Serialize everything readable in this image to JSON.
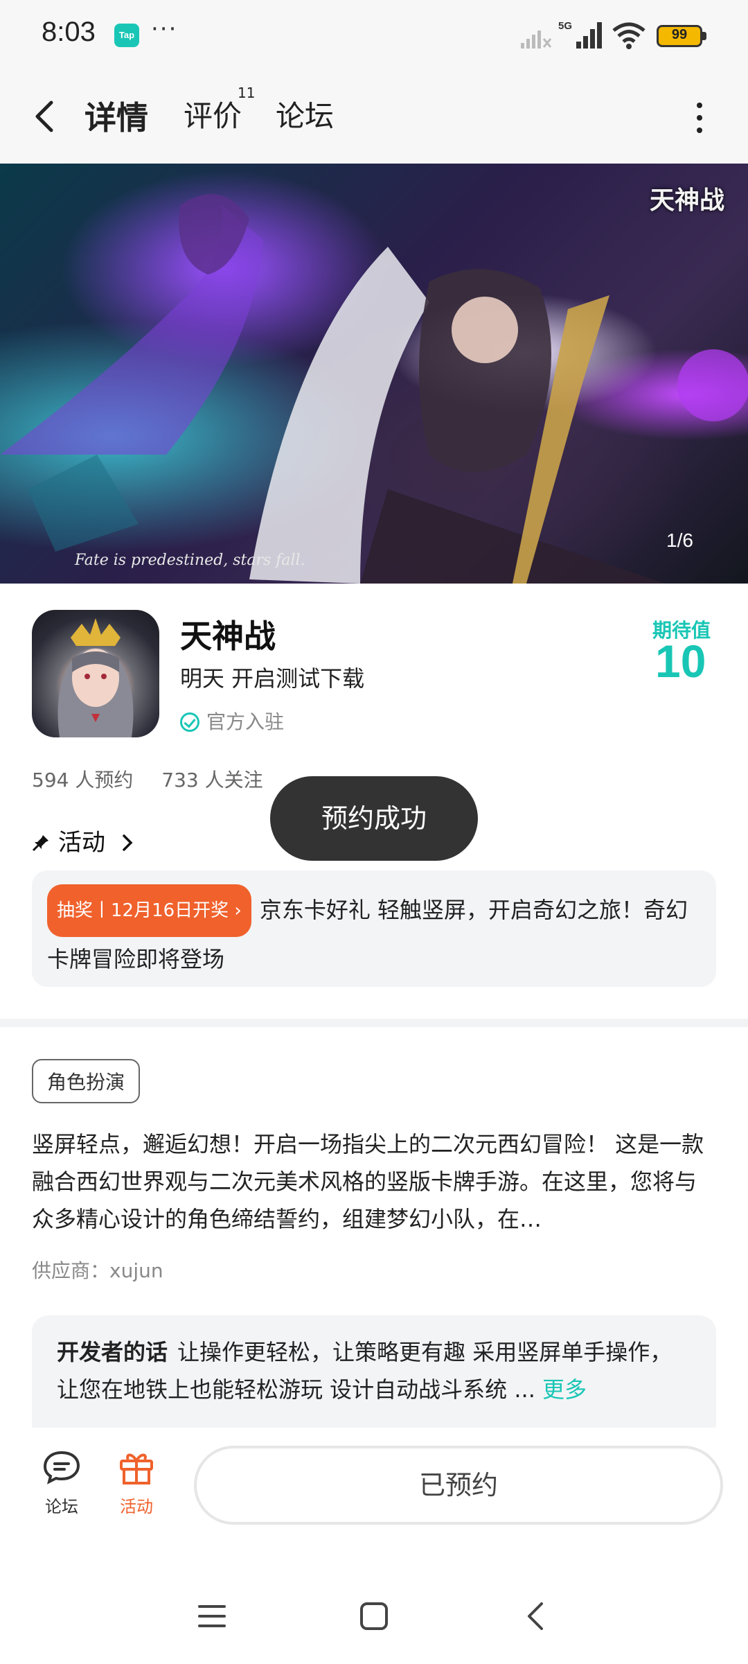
{
  "status_bar": {
    "time": "8:03",
    "app_badge": "Tap",
    "dots": "···",
    "network": "5G",
    "battery": "99"
  },
  "header": {
    "tabs": [
      {
        "label": "详情",
        "active": true
      },
      {
        "label": "评价",
        "badge": "11"
      },
      {
        "label": "论坛"
      }
    ]
  },
  "banner": {
    "logo_text": "天神战",
    "tagline": "Fate is predestined, stars fall.",
    "counter": "1/6"
  },
  "game": {
    "title": "天神战",
    "subtitle": "明天 开启测试下载",
    "official_label": "官方入驻",
    "expect_label": "期待值",
    "expect_value": "10"
  },
  "stats": {
    "reservations": "594 人预约",
    "follows": "733 人关注"
  },
  "activity": {
    "section_label": "活动",
    "lottery_tag": "抽奖丨12月16日开奖",
    "text": "京东卡好礼 轻触竖屏，开启奇幻之旅！奇幻卡牌冒险即将登场"
  },
  "toast": "预约成功",
  "tag": "角色扮演",
  "description": "竖屏轻点，邂逅幻想！开启一场指尖上的二次元西幻冒险！ 这是一款融合西幻世界观与二次元美术风格的竖版卡牌手游。在这里，您将与众多精心设计的角色缔结誓约，组建梦幻小队，在…",
  "supplier": "供应商：xujun",
  "developer": {
    "title": "开发者的话",
    "text": "让操作更轻松，让策略更有趣 采用竖屏单手操作，让您在地铁上也能轻松游玩 设计自动战斗系统 ...",
    "more": "更多"
  },
  "bottom_bar": {
    "forum_label": "论坛",
    "activity_label": "活动",
    "reserve_label": "已预约"
  },
  "colors": {
    "accent": "#19c6b5",
    "orange": "#f0612c"
  }
}
